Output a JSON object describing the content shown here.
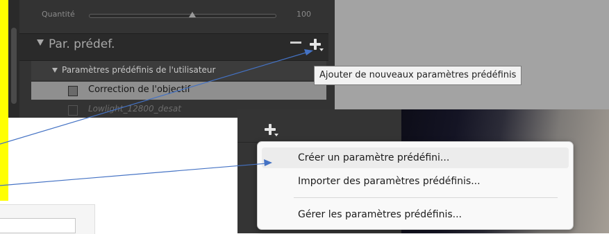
{
  "lightroom": {
    "quantity_label": "Quantité",
    "quantity_value": "100",
    "quantity_level_percent": 55,
    "presets_title": "Par. prédef.",
    "user_group_label": "Paramètres prédéfinis de l'utilisateur",
    "presets": [
      {
        "label": "Correction de l'objectif",
        "selected": true
      },
      {
        "label": "Lowlight_12800_desat",
        "selected": false
      }
    ],
    "tooltip": "Ajouter de nouveaux paramètres prédéfinis"
  },
  "context_menu": {
    "items": [
      {
        "label": "Créer un paramètre prédéfini...",
        "highlighted": true
      },
      {
        "label": "Importer des paramètres prédéfinis...",
        "highlighted": false
      },
      {
        "label": "Gérer les paramètres prédéfinis...",
        "highlighted": false
      }
    ]
  },
  "icons": {
    "add": "plus-icon",
    "remove": "minus-icon",
    "expand": "triangle-down-icon",
    "preset": "preset-icon"
  },
  "colors": {
    "highlight_yellow": "#ffff00",
    "arrow_blue": "#4472c4",
    "panel_dark": "#333333"
  }
}
